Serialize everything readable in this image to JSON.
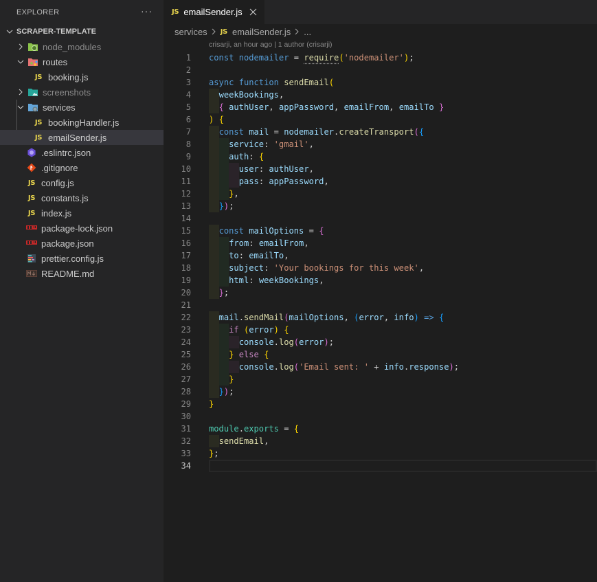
{
  "sidebar": {
    "title": "EXPLORER",
    "more_icon": "ellipsis-icon",
    "project": "SCRAPER-TEMPLATE",
    "items": [
      {
        "label": "node_modules",
        "type": "folder",
        "icon": "folder-node-icon",
        "expanded": false,
        "dim": true,
        "depth": 0
      },
      {
        "label": "routes",
        "type": "folder",
        "icon": "folder-routes-icon",
        "expanded": true,
        "dim": false,
        "depth": 0
      },
      {
        "label": "booking.js",
        "type": "file",
        "icon": "js-icon",
        "depth": 1
      },
      {
        "label": "screenshots",
        "type": "folder",
        "icon": "folder-images-icon",
        "expanded": false,
        "dim": true,
        "depth": 0
      },
      {
        "label": "services",
        "type": "folder",
        "icon": "folder-services-icon",
        "expanded": true,
        "dim": false,
        "depth": 0
      },
      {
        "label": "bookingHandler.js",
        "type": "file",
        "icon": "js-icon",
        "depth": 1
      },
      {
        "label": "emailSender.js",
        "type": "file",
        "icon": "js-icon",
        "depth": 1,
        "selected": true
      },
      {
        "label": ".eslintrc.json",
        "type": "file",
        "icon": "eslint-icon",
        "depth": 0
      },
      {
        "label": ".gitignore",
        "type": "file",
        "icon": "git-icon",
        "depth": 0
      },
      {
        "label": "config.js",
        "type": "file",
        "icon": "js-icon",
        "depth": 0
      },
      {
        "label": "constants.js",
        "type": "file",
        "icon": "js-icon",
        "depth": 0
      },
      {
        "label": "index.js",
        "type": "file",
        "icon": "js-icon",
        "depth": 0
      },
      {
        "label": "package-lock.json",
        "type": "file",
        "icon": "npm-icon",
        "depth": 0
      },
      {
        "label": "package.json",
        "type": "file",
        "icon": "npm-icon",
        "depth": 0
      },
      {
        "label": "prettier.config.js",
        "type": "file",
        "icon": "prettier-icon",
        "depth": 0
      },
      {
        "label": "README.md",
        "type": "file",
        "icon": "markdown-icon",
        "depth": 0
      }
    ]
  },
  "editor": {
    "tab": {
      "label": "emailSender.js",
      "icon_text": "JS"
    },
    "breadcrumb": {
      "folder": "services",
      "file": "emailSender.js",
      "more": "..."
    },
    "blame": "crisarji, an hour ago | 1 author (crisarji)",
    "active_line": 34,
    "line_numbers": [
      "1",
      "2",
      "3",
      "4",
      "5",
      "6",
      "7",
      "8",
      "9",
      "10",
      "11",
      "12",
      "13",
      "14",
      "15",
      "16",
      "17",
      "18",
      "19",
      "20",
      "21",
      "22",
      "23",
      "24",
      "25",
      "26",
      "27",
      "28",
      "29",
      "30",
      "31",
      "32",
      "33",
      "34"
    ],
    "code": {
      "l1": {
        "kw1": "const",
        "v1": "nodemailer",
        "op": " = ",
        "fn": "require",
        "p1": "(",
        "s": "'nodemailer'",
        "p2": ")",
        "semi": ";"
      },
      "l3": {
        "kw1": "async",
        "kw2": "function",
        "fn": "sendEmail",
        "p": "("
      },
      "l4": {
        "v": "weekBookings",
        "c": ","
      },
      "l5": {
        "b1": "{",
        "v1": "authUser",
        "v2": "appPassword",
        "v3": "emailFrom",
        "v4": "emailTo",
        "b2": "}",
        "sep": ", "
      },
      "l6": {
        "p": ")",
        "b": "{"
      },
      "l7": {
        "kw": "const",
        "v": "mail",
        "op": " = ",
        "obj": "nodemailer",
        "dot": ".",
        "fn": "createTransport",
        "p1": "(",
        "b1": "{"
      },
      "l8": {
        "k": "service",
        "colon": ": ",
        "s": "'gmail'",
        "c": ","
      },
      "l9": {
        "k": "auth",
        "colon": ": ",
        "b": "{"
      },
      "l10": {
        "k": "user",
        "colon": ": ",
        "v": "authUser",
        "c": ","
      },
      "l11": {
        "k": "pass",
        "colon": ": ",
        "v": "appPassword",
        "c": ","
      },
      "l12": {
        "b": "}",
        "c": ","
      },
      "l13": {
        "b": "}",
        "p": ")",
        "semi": ";"
      },
      "l15": {
        "kw": "const",
        "v": "mailOptions",
        "op": " = ",
        "b": "{"
      },
      "l16": {
        "k": "from",
        "colon": ": ",
        "v": "emailFrom",
        "c": ","
      },
      "l17": {
        "k": "to",
        "colon": ": ",
        "v": "emailTo",
        "c": ","
      },
      "l18": {
        "k": "subject",
        "colon": ": ",
        "s": "'Your bookings for this week'",
        "c": ","
      },
      "l19": {
        "k": "html",
        "colon": ": ",
        "v": "weekBookings",
        "c": ","
      },
      "l20": {
        "b": "}",
        "semi": ";"
      },
      "l22": {
        "obj": "mail",
        "dot": ".",
        "fn": "sendMail",
        "p1": "(",
        "v1": "mailOptions",
        "c": ", ",
        "p2": "(",
        "v2": "error",
        "c2": ", ",
        "v3": "info",
        "p3": ")",
        "arrow": " => ",
        "b": "{"
      },
      "l23": {
        "kw": "if",
        "sp": " ",
        "p1": "(",
        "v": "error",
        "p2": ")",
        "b": "{"
      },
      "l24": {
        "obj": "console",
        "dot": ".",
        "fn": "log",
        "p1": "(",
        "v": "error",
        "p2": ")",
        "semi": ";"
      },
      "l25": {
        "b1": "}",
        "kw": "else",
        "b2": "{"
      },
      "l26": {
        "obj": "console",
        "dot": ".",
        "fn": "log",
        "p1": "(",
        "s": "'Email sent: '",
        "op": " + ",
        "v1": "info",
        "dot2": ".",
        "v2": "response",
        "p2": ")",
        "semi": ";"
      },
      "l27": {
        "b": "}"
      },
      "l28": {
        "b": "}",
        "p": ")",
        "semi": ";"
      },
      "l29": {
        "b": "}"
      },
      "l31": {
        "obj": "module",
        "dot": ".",
        "prop": "exports",
        "op": " = ",
        "b": "{"
      },
      "l32": {
        "v": "sendEmail",
        "c": ","
      },
      "l33": {
        "b": "}",
        "semi": ";"
      }
    }
  },
  "colors": {
    "sidebar_bg": "#252526",
    "editor_bg": "#1e1e1e",
    "selected_row": "#37373d",
    "js_yellow": "#e8d44d",
    "keyword": "#569cd6",
    "string": "#ce9178",
    "function": "#dcdcaa",
    "variable": "#9cdcfe"
  }
}
